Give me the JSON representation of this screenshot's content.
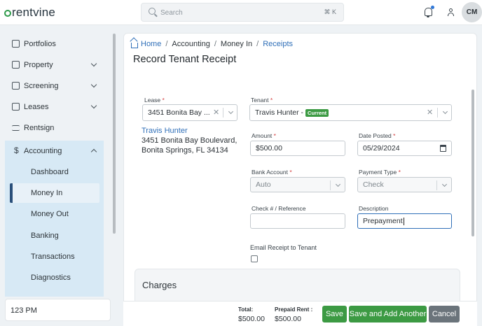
{
  "app": {
    "logo_text": "rentvine",
    "brand_color": "#2e9a4a",
    "accent_color": "#2f6fb8"
  },
  "topbar": {
    "search_placeholder": "Search",
    "search_shortcut": "⌘ K",
    "avatar_initials": "CM"
  },
  "sidebar": {
    "items": [
      {
        "label": "Portfolios",
        "icon": "folder-icon"
      },
      {
        "label": "Property",
        "icon": "house-icon"
      },
      {
        "label": "Screening",
        "icon": "screening-icon"
      },
      {
        "label": "Leases",
        "icon": "clipboard-icon"
      },
      {
        "label": "Rentsign",
        "icon": "sign-icon"
      }
    ],
    "accounting": {
      "label": "Accounting",
      "sub": [
        "Dashboard",
        "Money In",
        "Money Out",
        "Banking",
        "Transactions",
        "Diagnostics"
      ],
      "selected": "Money In"
    },
    "clock": "123 PM"
  },
  "breadcrumb": {
    "home": "Home",
    "accounting": "Accounting",
    "money_in": "Money In",
    "receipts": "Receipts",
    "sep": "/"
  },
  "page": {
    "title": "Record Tenant Receipt"
  },
  "form": {
    "lease": {
      "label": "Lease",
      "value": "3451 Bonita Bay ..."
    },
    "tenant": {
      "label": "Tenant",
      "value": "Travis Hunter -",
      "badge": "Current"
    },
    "amount": {
      "label": "Amount",
      "value": "$500.00"
    },
    "date_posted": {
      "label": "Date Posted",
      "value": "05/29/2024"
    },
    "bank_account": {
      "label": "Bank Account",
      "value": "Auto"
    },
    "payment_type": {
      "label": "Payment Type",
      "value": "Check"
    },
    "check_ref": {
      "label": "Check # / Reference",
      "value": ""
    },
    "description": {
      "label": "Description",
      "value": "Prepayment"
    },
    "email_receipt": {
      "label": "Email Receipt to Tenant",
      "checked": false
    },
    "required_mark": "*",
    "clear_glyph": "✕"
  },
  "tenant_card": {
    "name": "Travis Hunter",
    "address_line1": "3451 Bonita Bay Boulevard,",
    "address_line2": "Bonita Springs, FL 34134"
  },
  "charges": {
    "title": "Charges"
  },
  "footer": {
    "total_label": "Total:",
    "total_value": "$500.00",
    "prepaid_label": "Prepaid Rent :",
    "prepaid_value": "$500.00",
    "save": "Save",
    "save_add": "Save and Add Another",
    "cancel": "Cancel"
  }
}
